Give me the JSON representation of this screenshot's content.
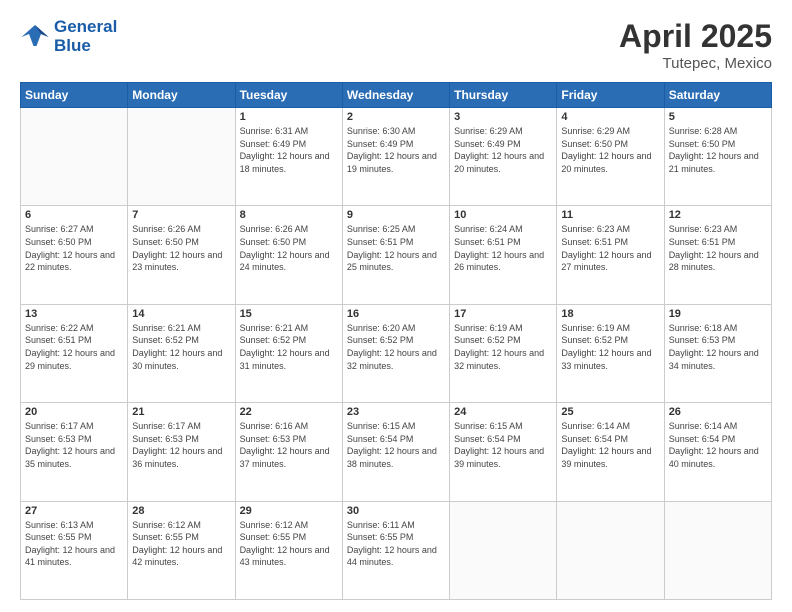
{
  "header": {
    "logo_line1": "General",
    "logo_line2": "Blue",
    "title": "April 2025",
    "location": "Tutepec, Mexico"
  },
  "weekdays": [
    "Sunday",
    "Monday",
    "Tuesday",
    "Wednesday",
    "Thursday",
    "Friday",
    "Saturday"
  ],
  "weeks": [
    [
      {
        "day": "",
        "info": ""
      },
      {
        "day": "",
        "info": ""
      },
      {
        "day": "1",
        "info": "Sunrise: 6:31 AM\nSunset: 6:49 PM\nDaylight: 12 hours and 18 minutes."
      },
      {
        "day": "2",
        "info": "Sunrise: 6:30 AM\nSunset: 6:49 PM\nDaylight: 12 hours and 19 minutes."
      },
      {
        "day": "3",
        "info": "Sunrise: 6:29 AM\nSunset: 6:49 PM\nDaylight: 12 hours and 20 minutes."
      },
      {
        "day": "4",
        "info": "Sunrise: 6:29 AM\nSunset: 6:50 PM\nDaylight: 12 hours and 20 minutes."
      },
      {
        "day": "5",
        "info": "Sunrise: 6:28 AM\nSunset: 6:50 PM\nDaylight: 12 hours and 21 minutes."
      }
    ],
    [
      {
        "day": "6",
        "info": "Sunrise: 6:27 AM\nSunset: 6:50 PM\nDaylight: 12 hours and 22 minutes."
      },
      {
        "day": "7",
        "info": "Sunrise: 6:26 AM\nSunset: 6:50 PM\nDaylight: 12 hours and 23 minutes."
      },
      {
        "day": "8",
        "info": "Sunrise: 6:26 AM\nSunset: 6:50 PM\nDaylight: 12 hours and 24 minutes."
      },
      {
        "day": "9",
        "info": "Sunrise: 6:25 AM\nSunset: 6:51 PM\nDaylight: 12 hours and 25 minutes."
      },
      {
        "day": "10",
        "info": "Sunrise: 6:24 AM\nSunset: 6:51 PM\nDaylight: 12 hours and 26 minutes."
      },
      {
        "day": "11",
        "info": "Sunrise: 6:23 AM\nSunset: 6:51 PM\nDaylight: 12 hours and 27 minutes."
      },
      {
        "day": "12",
        "info": "Sunrise: 6:23 AM\nSunset: 6:51 PM\nDaylight: 12 hours and 28 minutes."
      }
    ],
    [
      {
        "day": "13",
        "info": "Sunrise: 6:22 AM\nSunset: 6:51 PM\nDaylight: 12 hours and 29 minutes."
      },
      {
        "day": "14",
        "info": "Sunrise: 6:21 AM\nSunset: 6:52 PM\nDaylight: 12 hours and 30 minutes."
      },
      {
        "day": "15",
        "info": "Sunrise: 6:21 AM\nSunset: 6:52 PM\nDaylight: 12 hours and 31 minutes."
      },
      {
        "day": "16",
        "info": "Sunrise: 6:20 AM\nSunset: 6:52 PM\nDaylight: 12 hours and 32 minutes."
      },
      {
        "day": "17",
        "info": "Sunrise: 6:19 AM\nSunset: 6:52 PM\nDaylight: 12 hours and 32 minutes."
      },
      {
        "day": "18",
        "info": "Sunrise: 6:19 AM\nSunset: 6:52 PM\nDaylight: 12 hours and 33 minutes."
      },
      {
        "day": "19",
        "info": "Sunrise: 6:18 AM\nSunset: 6:53 PM\nDaylight: 12 hours and 34 minutes."
      }
    ],
    [
      {
        "day": "20",
        "info": "Sunrise: 6:17 AM\nSunset: 6:53 PM\nDaylight: 12 hours and 35 minutes."
      },
      {
        "day": "21",
        "info": "Sunrise: 6:17 AM\nSunset: 6:53 PM\nDaylight: 12 hours and 36 minutes."
      },
      {
        "day": "22",
        "info": "Sunrise: 6:16 AM\nSunset: 6:53 PM\nDaylight: 12 hours and 37 minutes."
      },
      {
        "day": "23",
        "info": "Sunrise: 6:15 AM\nSunset: 6:54 PM\nDaylight: 12 hours and 38 minutes."
      },
      {
        "day": "24",
        "info": "Sunrise: 6:15 AM\nSunset: 6:54 PM\nDaylight: 12 hours and 39 minutes."
      },
      {
        "day": "25",
        "info": "Sunrise: 6:14 AM\nSunset: 6:54 PM\nDaylight: 12 hours and 39 minutes."
      },
      {
        "day": "26",
        "info": "Sunrise: 6:14 AM\nSunset: 6:54 PM\nDaylight: 12 hours and 40 minutes."
      }
    ],
    [
      {
        "day": "27",
        "info": "Sunrise: 6:13 AM\nSunset: 6:55 PM\nDaylight: 12 hours and 41 minutes."
      },
      {
        "day": "28",
        "info": "Sunrise: 6:12 AM\nSunset: 6:55 PM\nDaylight: 12 hours and 42 minutes."
      },
      {
        "day": "29",
        "info": "Sunrise: 6:12 AM\nSunset: 6:55 PM\nDaylight: 12 hours and 43 minutes."
      },
      {
        "day": "30",
        "info": "Sunrise: 6:11 AM\nSunset: 6:55 PM\nDaylight: 12 hours and 44 minutes."
      },
      {
        "day": "",
        "info": ""
      },
      {
        "day": "",
        "info": ""
      },
      {
        "day": "",
        "info": ""
      }
    ]
  ]
}
